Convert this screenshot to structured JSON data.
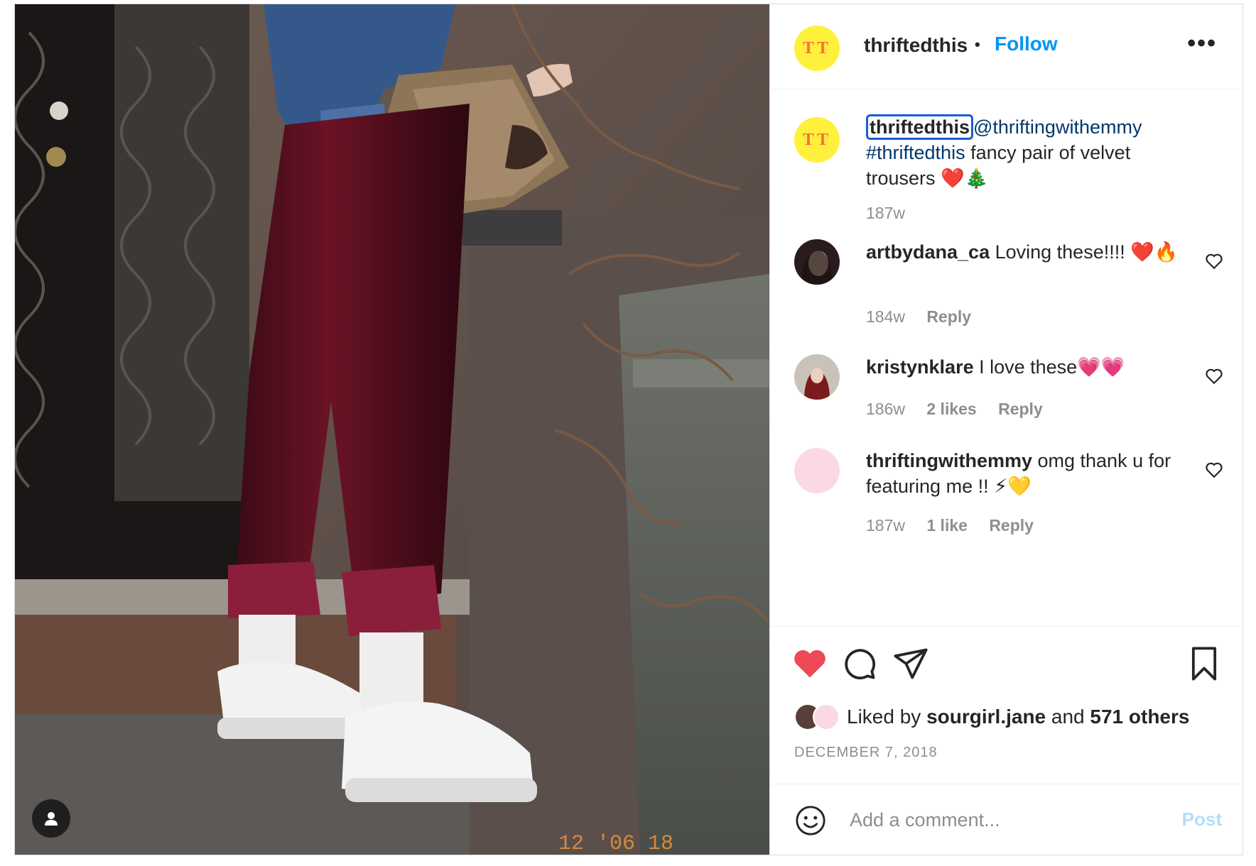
{
  "post": {
    "author": "thriftedthis",
    "follow_label": "Follow",
    "separator": "•",
    "avatar_initials": "TT",
    "caption": {
      "author": "thriftedthis",
      "mention": "@thriftingwithemmy",
      "hashtag": "#thriftedthis",
      "text": " fancy pair of velvet trousers ❤️🎄",
      "time": "187w"
    },
    "photo_stamp": "12 '06 18"
  },
  "comments": [
    {
      "user": "artbydana_ca",
      "text": " Loving these!!!! ❤️🔥",
      "time": "184w",
      "likes": "",
      "reply": "Reply",
      "avatar_color": "#3b2a2a"
    },
    {
      "user": "kristynklare",
      "text": " I love these💗💗",
      "time": "186w",
      "likes": "2 likes",
      "reply": "Reply",
      "avatar_color": "#5a2525"
    },
    {
      "user": "thriftingwithemmy",
      "text": " omg thank u for featuring me !! ⚡💛",
      "time": "187w",
      "likes": "1 like",
      "reply": "Reply",
      "avatar_color": "#fbd9e3"
    }
  ],
  "actions": {
    "liked_by_prefix": "Liked by ",
    "liked_by_user": "sourgirl.jane",
    "liked_by_and": " and ",
    "liked_by_others": "571 others",
    "date": "DECEMBER 7, 2018"
  },
  "comment_box": {
    "placeholder": "Add a comment...",
    "post_label": "Post"
  },
  "colors": {
    "accent": "#0095f6",
    "like_red": "#ed4956",
    "muted": "#8e8e8e"
  }
}
